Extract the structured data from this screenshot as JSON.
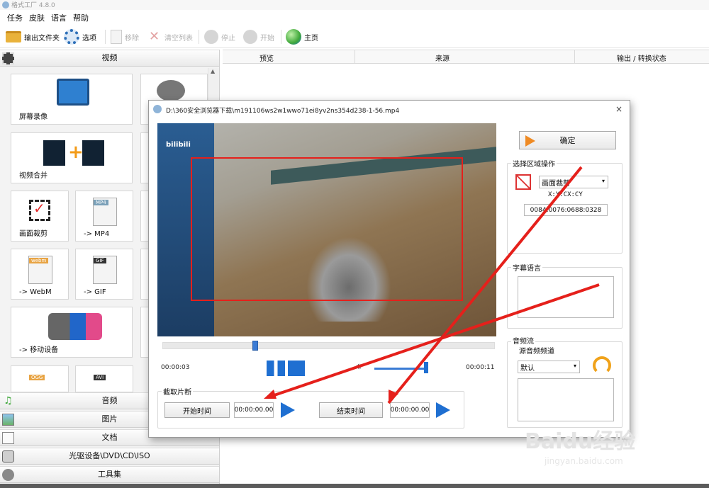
{
  "app": {
    "title": "格式工厂 4.8.0"
  },
  "menu": [
    "任务",
    "皮肤",
    "语言",
    "帮助"
  ],
  "toolbar": {
    "output_folder": "输出文件夹",
    "options": "选项",
    "remove": "移除",
    "clear_list": "清空列表",
    "stop": "停止",
    "start": "开始",
    "home": "主页"
  },
  "categories": {
    "video": "视频",
    "audio": "音频",
    "image": "图片",
    "document": "文档",
    "disc": "光驱设备\\DVD\\CD\\ISO",
    "tools": "工具集"
  },
  "video_tiles": [
    "屏幕录像",
    "视频合并",
    "画面裁剪",
    "-> MP4",
    "-> WebM",
    "-> GIF",
    "-> 移动设备"
  ],
  "tile_badges": {
    "mp4": "MP4",
    "gif": "GIF",
    "avi": "AVI",
    "webm": "webm",
    "ogg": "OGG"
  },
  "list_columns": [
    "预览",
    "来源",
    "输出 / 转换状态"
  ],
  "dialog": {
    "title": "D:\\360安全浏览器下载\\m191106ws2w1wwo71ei8yv2ns354d238-1-56.mp4",
    "close": "×",
    "video_watermark": "bilibili",
    "time_current": "00:00:03",
    "time_total": "00:00:11",
    "ok_button": "确定",
    "region_group": "选择区域操作",
    "region_select": "画面裁剪",
    "region_format": "X:Y:CX:CY",
    "region_value": "0084:0076:0688:0328",
    "subtitle_group": "字幕语言",
    "audio_group": "音频流",
    "audio_channel_label": "源音频频道",
    "audio_channel_select": "默认",
    "clip_group": "截取片断",
    "start_time_button": "开始时间",
    "start_time_value": "00:00:00.00",
    "end_time_button": "结束时间",
    "end_time_value": "00:00:00.00"
  },
  "watermark": {
    "logo": "Baidu经验",
    "url": "jingyan.baidu.com"
  },
  "colors": {
    "accent_blue": "#1f6fd1",
    "annotation_red": "#e5201b",
    "title_gray": "#9a9a9a"
  }
}
